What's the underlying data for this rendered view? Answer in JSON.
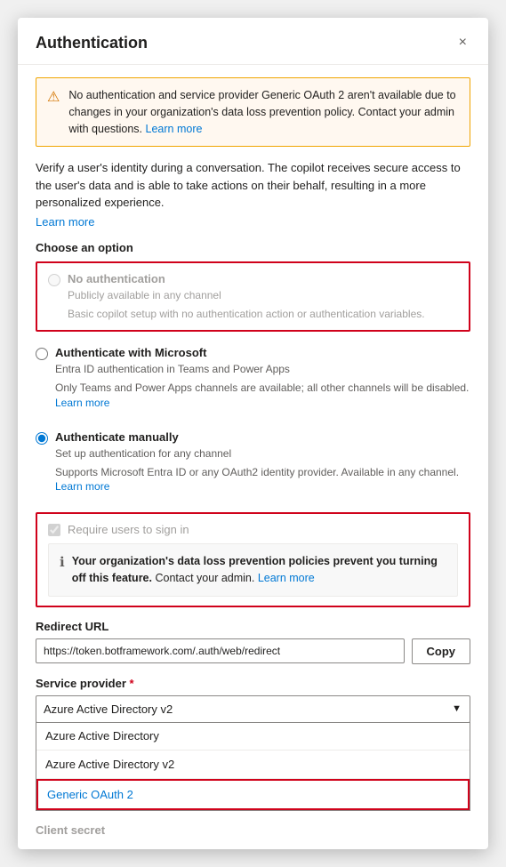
{
  "dialog": {
    "title": "Authentication",
    "close_icon": "×"
  },
  "warning": {
    "icon": "⚠",
    "text": "No authentication and service provider Generic OAuth 2 aren't available due to changes in your organization's data loss prevention policy. Contact your admin with questions.",
    "learn_more": "Learn more"
  },
  "description": {
    "text": "Verify a user's identity during a conversation. The copilot receives secure access to the user's data and is able to take actions on their behalf, resulting in a more personalized experience.",
    "learn_more": "Learn more"
  },
  "choose_option": {
    "label": "Choose an option"
  },
  "options": [
    {
      "id": "no-auth",
      "label": "No authentication",
      "description1": "Publicly available in any channel",
      "description2": "Basic copilot setup with no authentication action or authentication variables.",
      "selected": false,
      "disabled": true
    },
    {
      "id": "microsoft-auth",
      "label": "Authenticate with Microsoft",
      "description1": "Entra ID authentication in Teams and Power Apps",
      "description2": "Only Teams and Power Apps channels are available; all other channels will be disabled.",
      "learn_more": "Learn more",
      "selected": false,
      "disabled": false
    },
    {
      "id": "manual-auth",
      "label": "Authenticate manually",
      "description1": "Set up authentication for any channel",
      "description2": "Supports Microsoft Entra ID or any OAuth2 identity provider. Available in any channel.",
      "learn_more": "Learn more",
      "selected": true,
      "disabled": false
    }
  ],
  "require_signin": {
    "label": "Require users to sign in",
    "checked": true
  },
  "dlp_warning": {
    "icon": "ℹ",
    "text_bold": "Your organization's data loss prevention policies prevent you turning off this feature.",
    "text_normal": "Contact your admin.",
    "learn_more": "Learn more"
  },
  "redirect_url": {
    "label": "Redirect URL",
    "value": "https://token.botframework.com/.auth/web/redirect",
    "copy_label": "Copy"
  },
  "service_provider": {
    "label": "Service provider",
    "required": true,
    "selected": "Azure Active Directory v2",
    "options": [
      "Azure Active Directory",
      "Azure Active Directory v2",
      "Generic OAuth 2"
    ]
  },
  "client_secret": {
    "label": "Client secret"
  }
}
